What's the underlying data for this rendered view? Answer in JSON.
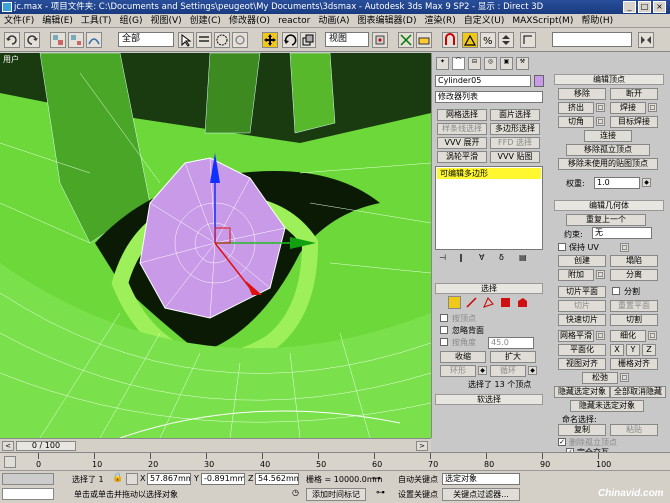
{
  "title_bar": {
    "text": "jc.max  - 项目文件夹: C:\\Documents and Settings\\peugeot\\My Documents\\3dsmax   - Autodesk 3ds Max 9 SP2   - 显示 : Direct 3D",
    "minimize": "_",
    "maximize": "□",
    "close": "×"
  },
  "menu": [
    "文件(F)",
    "编辑(E)",
    "工具(T)",
    "组(G)",
    "视图(V)",
    "创建(C)",
    "修改器(O)",
    "reactor",
    "动画(A)",
    "图表编辑器(D)",
    "渲染(R)",
    "自定义(U)",
    "MAXScript(M)",
    "帮助(H)"
  ],
  "toolbar": {
    "selection_filter": "全部",
    "reference_coord": "视图",
    "named_selection": ""
  },
  "viewport": {
    "label": "用户"
  },
  "command_panel": {
    "object_name": "Cylinder05",
    "modifier_list": "修改器列表",
    "buttons": [
      {
        "label": "网格选择",
        "dim": false
      },
      {
        "label": "面片选择",
        "dim": false
      },
      {
        "label": "样条线选择",
        "dim": true
      },
      {
        "label": "多边形选择",
        "dim": false
      },
      {
        "label": "VVV 展开",
        "dim": false
      },
      {
        "label": "FFD 选择",
        "dim": true
      },
      {
        "label": "涡轮平滑",
        "dim": false
      },
      {
        "label": "VVV 贴图",
        "dim": false
      }
    ],
    "stack_item": "可编辑多边形",
    "selection_rollout": {
      "header": "选择",
      "by_vertex": "按顶点",
      "ignore_backfacing": "忽略背面",
      "by_angle": "按角度",
      "angle_value": "45.0",
      "shrink": "收缩",
      "grow": "扩大",
      "ring": "环形",
      "loop": "循环",
      "status": "选择了 13 个顶点"
    },
    "soft_selection_header": "软选择"
  },
  "right_panel": {
    "edit_vertices": {
      "header": "编辑顶点",
      "remove": "移除",
      "break": "断开",
      "extrude": "挤出",
      "weld": "焊接",
      "chamfer": "切角",
      "target_weld": "目标焊接",
      "connect": "连接",
      "remove_isolated": "移除孤立顶点",
      "remove_unused_map": "移除未使用的贴图顶点",
      "weight_label": "权重:",
      "weight_value": "1.0"
    },
    "edit_geometry": {
      "header": "编辑几何体",
      "repeat_last": "重复上一个",
      "constraints_label": "约束:",
      "constraints_value": "无",
      "preserve_uv": "保持 UV",
      "create": "创建",
      "collapse": "塌陷",
      "attach": "附加",
      "detach": "分离",
      "slice_plane": "切片平面",
      "split": "分割",
      "slice": "切片",
      "reset_plane": "重置平面",
      "quickslice": "快速切片",
      "cut": "切割",
      "meshsmooth": "网格平滑",
      "tessellate": "细化",
      "make_planar": "平面化",
      "x": "X",
      "y": "Y",
      "z": "Z",
      "view_align": "视图对齐",
      "grid_align": "栅格对齐",
      "relax": "松弛",
      "hide_selected": "隐藏选定对象",
      "unhide_all": "全部取消隐藏",
      "hide_unselected": "隐藏未选定对象",
      "named_selections": "命名选择:",
      "copy": "复制",
      "paste": "粘贴",
      "delete_isolated": "删除孤立顶点",
      "full_interactivity": "完全交互"
    }
  },
  "timeline": {
    "frame": "0 / 100"
  },
  "ruler_ticks": [
    "0",
    "10",
    "20",
    "30",
    "40",
    "50",
    "60",
    "70",
    "80",
    "90",
    "100"
  ],
  "status": {
    "selected": "选择了 1",
    "x_label": "X",
    "x_value": "57.867mm",
    "y_label": "Y",
    "y_value": "-0.891mm",
    "z_label": "Z",
    "z_value": "54.562mm",
    "grid": "栅格 = 10000.0mm",
    "auto_key": "自动关键点",
    "auto_key_filter": "选定对象",
    "prompt": "单击或单击并拖动以选择对象",
    "add_time_tag": "添加时间标记",
    "set_key": "设置关键点",
    "key_filters": "关键点过滤器...",
    "watermark": "Chinavid.com"
  },
  "colors": {
    "viewport_green": "#6cd83a",
    "poly_lilac": "#c89ae8",
    "title_blue": "#1e4590",
    "stack_yellow": "#fff830",
    "hilite_yellow": "#f0c818"
  }
}
